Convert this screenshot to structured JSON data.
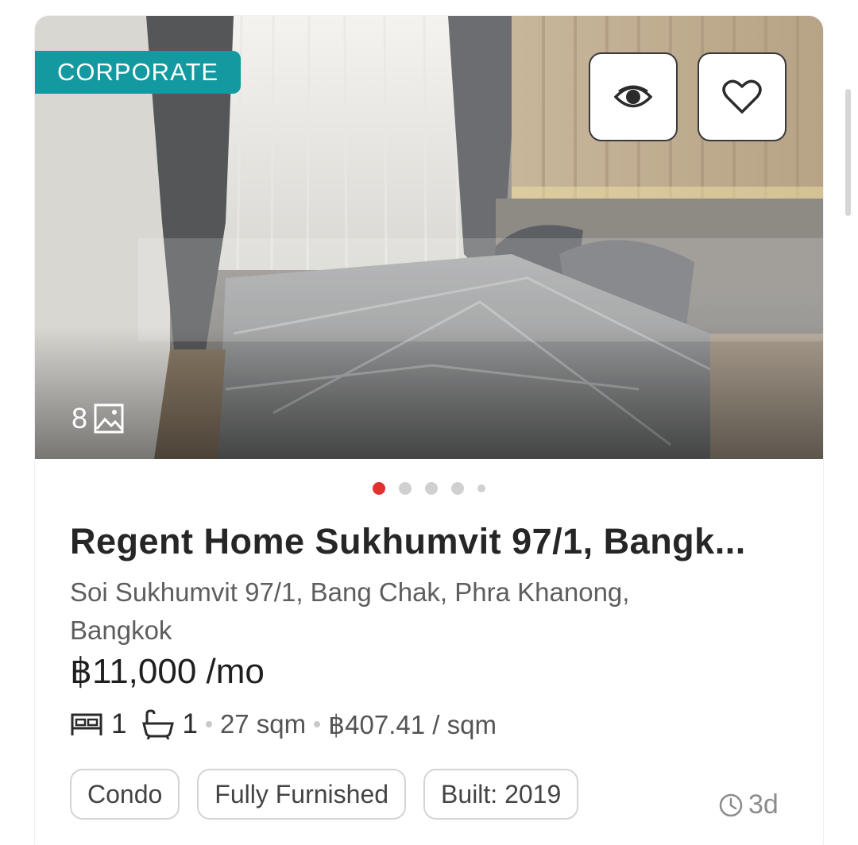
{
  "listing": {
    "badge": "CORPORATE",
    "photo_count": "8",
    "carousel": {
      "total_dots": 5,
      "active_index": 0
    },
    "title": "Regent Home Sukhumvit 97/1, Bangk...",
    "address": "Soi Sukhumvit 97/1, Bang Chak, Phra Khanong, Bangkok",
    "price": "฿11,000 /mo",
    "bedrooms": "1",
    "bathrooms": "1",
    "area": "27 sqm",
    "price_per_sqm": "฿407.41 / sqm",
    "tags": [
      "Condo",
      "Fully Furnished",
      "Built: 2019"
    ],
    "posted_ago": "3d"
  },
  "icons": {
    "view": "eye-icon",
    "favorite": "heart-icon",
    "photos": "image-icon",
    "bed": "bed-icon",
    "bath": "bathtub-icon",
    "time": "clock-icon"
  },
  "colors": {
    "badge": "#139aa0",
    "active_dot": "#e0312e",
    "inactive_dot": "#d0d0d0"
  }
}
